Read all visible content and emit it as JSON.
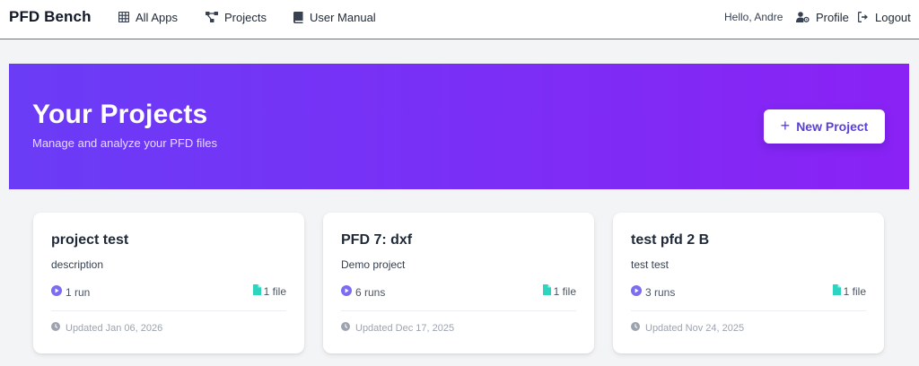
{
  "nav": {
    "brand": "PFD Bench",
    "links": [
      {
        "label": "All Apps",
        "icon": "grid-icon"
      },
      {
        "label": "Projects",
        "icon": "project-diagram-icon"
      },
      {
        "label": "User Manual",
        "icon": "book-icon"
      }
    ],
    "greeting": "Hello, Andre",
    "profile_label": "Profile",
    "logout_label": "Logout"
  },
  "hero": {
    "title": "Your Projects",
    "subtitle": "Manage and analyze your PFD files",
    "new_project_label": "New Project",
    "gradient_start": "#6a3cf6",
    "gradient_end": "#8a22f5"
  },
  "projects": [
    {
      "name": "project test",
      "description": "description",
      "runs": "1 run",
      "files": "1 file",
      "updated": "Updated Jan 06, 2026"
    },
    {
      "name": "PFD 7: dxf",
      "description": "Demo project",
      "runs": "6 runs",
      "files": "1 file",
      "updated": "Updated Dec 17, 2025"
    },
    {
      "name": "test pfd 2 B",
      "description": "test test",
      "runs": "3 runs",
      "files": "1 file",
      "updated": "Updated Nov 24, 2025"
    }
  ],
  "colors": {
    "accent": "#5b3fd8",
    "run_icon": "#7c6cf0",
    "file_icon": "#2dd4bf",
    "muted": "#9ca3af"
  }
}
